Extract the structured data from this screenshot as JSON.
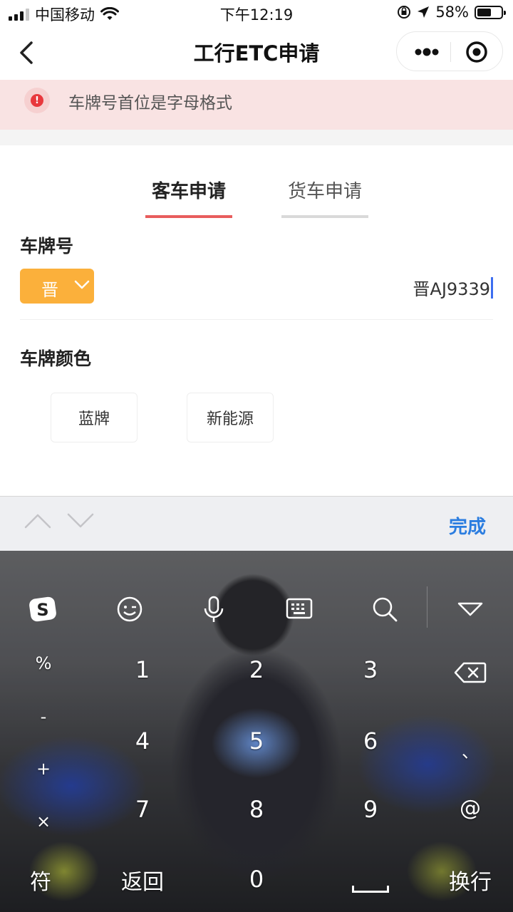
{
  "status_bar": {
    "carrier": "中国移动",
    "time": "下午12:19",
    "battery_text": "58%",
    "battery_level": 0.58
  },
  "nav": {
    "title": "工行ETC申请"
  },
  "alert": {
    "message": "车牌号首位是字母格式"
  },
  "tabs": [
    {
      "label": "客车申请",
      "active": true
    },
    {
      "label": "货车申请",
      "active": false
    }
  ],
  "plate": {
    "label": "车牌号",
    "province": "晋",
    "value": "晋AJ9339"
  },
  "plate_color": {
    "label": "车牌颜色",
    "options": [
      "蓝牌",
      "新能源"
    ]
  },
  "accessory": {
    "done_label": "完成"
  },
  "keyboard": {
    "left_symbols": [
      "%",
      "-",
      "+",
      "×"
    ],
    "rows": [
      [
        "1",
        "2",
        "3"
      ],
      [
        "4",
        "5",
        "6"
      ],
      [
        "7",
        "8",
        "9"
      ]
    ],
    "right_keys": [
      "、",
      "@"
    ],
    "bottom": {
      "symbol_key": "符",
      "back_key": "返回",
      "zero_key": "0",
      "enter_key": "换行"
    },
    "toolbar_icons": [
      "sogou-logo-icon",
      "emoji-icon",
      "microphone-icon",
      "keyboard-icon",
      "search-icon",
      "collapse-keyboard-icon"
    ]
  },
  "colors": {
    "accent_orange": "#fbb03b",
    "tab_active": "#e85d5d",
    "done_blue": "#2b7de0",
    "alert_bg": "#f9e3e3",
    "alert_red": "#e8383d"
  }
}
